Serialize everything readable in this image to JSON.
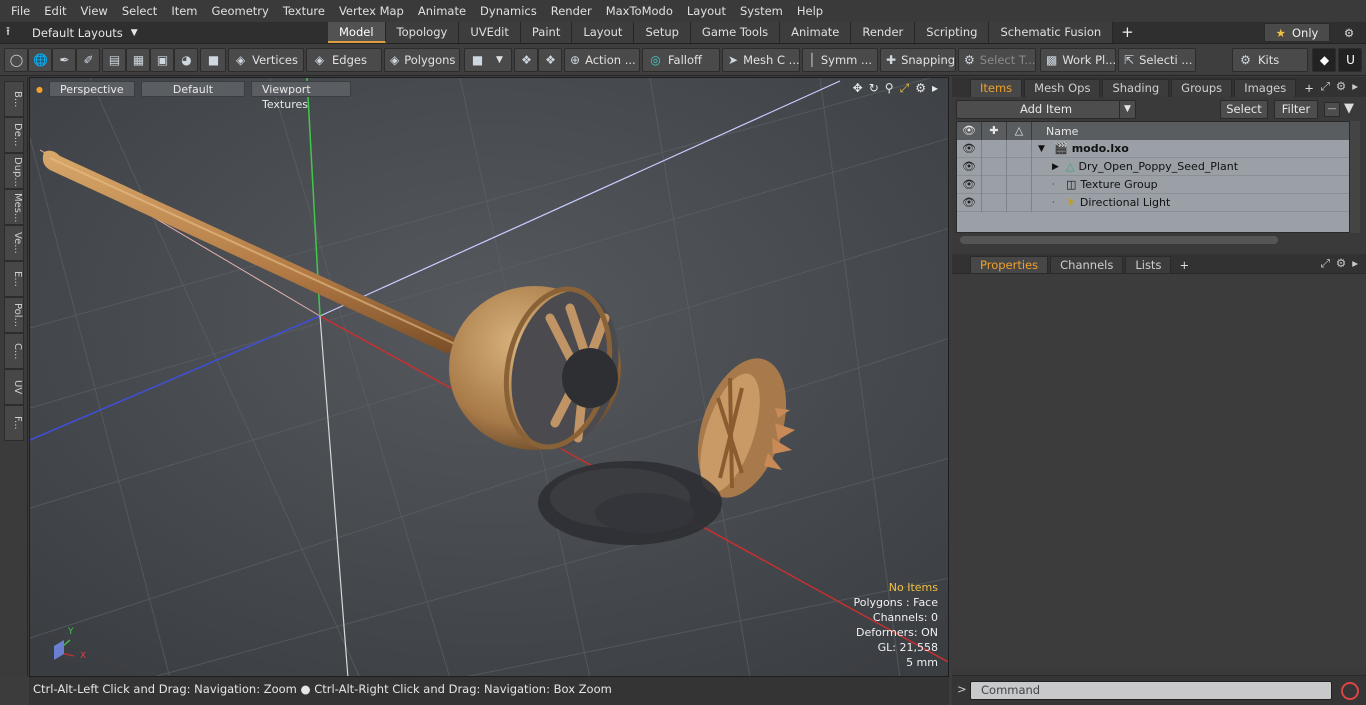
{
  "menu": [
    "File",
    "Edit",
    "View",
    "Select",
    "Item",
    "Geometry",
    "Texture",
    "Vertex Map",
    "Animate",
    "Dynamics",
    "Render",
    "MaxToModo",
    "Layout",
    "System",
    "Help"
  ],
  "layout_selector": "Default Layouts",
  "tabs": [
    "Model",
    "Topology",
    "UVEdit",
    "Paint",
    "Layout",
    "Setup",
    "Game Tools",
    "Animate",
    "Render",
    "Scripting",
    "Schematic Fusion"
  ],
  "active_tab": "Model",
  "only_label": "Only",
  "toolbar": {
    "vertices": "Vertices",
    "edges": "Edges",
    "polygons": "Polygons",
    "action": "Action ...",
    "falloff": "Falloff",
    "mesh": "Mesh C ...",
    "symm": "Symm ...",
    "snapping": "Snapping",
    "select_t": "Select T...",
    "work_pl": "Work Pl...",
    "selecti": "Selecti ...",
    "kits": "Kits"
  },
  "left_tabs": [
    "B...",
    "De...",
    "Dup...",
    "Mes...",
    "Ve...",
    "E...",
    "Pol...",
    "C...",
    "UV",
    "F..."
  ],
  "viewport": {
    "view_mode": "Perspective",
    "shading": "Default",
    "textures": "Viewport Textures",
    "info": {
      "selection": "No Items",
      "polygons": "Polygons : Face",
      "channels": "Channels: 0",
      "deformers": "Deformers: ON",
      "gl": "GL: 21,558",
      "scale": "5 mm"
    }
  },
  "status": "Ctrl-Alt-Left Click and Drag: Navigation: Zoom ● Ctrl-Alt-Right Click and Drag: Navigation: Box Zoom",
  "items_panel": {
    "tabs": [
      "Items",
      "Mesh Ops",
      "Shading",
      "Groups",
      "Images"
    ],
    "add_item": "Add Item",
    "select": "Select",
    "filter": "Filter",
    "column_name": "Name",
    "rows": [
      {
        "label": "modo.lxo"
      },
      {
        "label": "Dry_Open_Poppy_Seed_Plant"
      },
      {
        "label": "Texture Group"
      },
      {
        "label": "Directional Light"
      }
    ]
  },
  "props_panel": {
    "tabs": [
      "Properties",
      "Channels",
      "Lists"
    ]
  },
  "command_placeholder": "Command"
}
